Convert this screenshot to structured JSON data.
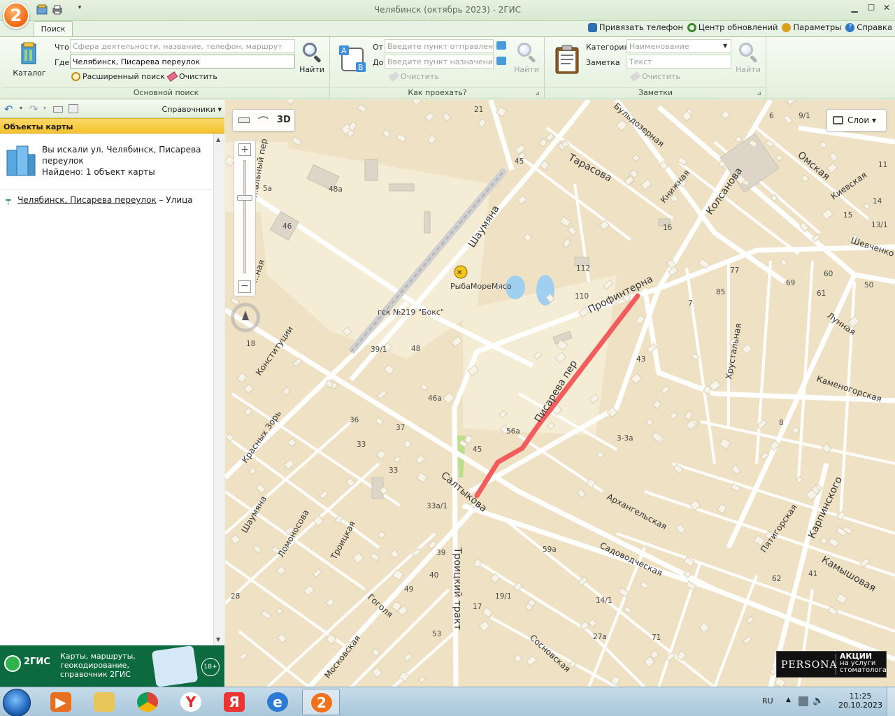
{
  "window": {
    "title": "Челябинск (октябрь 2023) - 2ГИС",
    "logo_text": "2",
    "tab_search": "Поиск",
    "links": [
      "Привязать телефон",
      "Центр обновлений",
      "Параметры",
      "Справка"
    ]
  },
  "ribbon": {
    "main_search": {
      "catalog_label": "Каталог",
      "what_label": "Что",
      "what_placeholder": "Сфера деятельности, название, телефон, маршрут",
      "where_label": "Где",
      "where_value": "Челябинск, Писарева переулок",
      "find_label": "Найти",
      "advanced_label": "Расширенный поиск",
      "clear_label": "Очистить",
      "group_title": "Основной поиск"
    },
    "route": {
      "from_label": "От",
      "from_placeholder": "Введите пункт отправления",
      "to_label": "До",
      "to_placeholder": "Введите пункт назначения",
      "clear_label": "Очистить",
      "find_label": "Найти",
      "group_title": "Как проехать?"
    },
    "notes": {
      "category_label": "Категория",
      "category_placeholder": "Наименование",
      "note_label": "Заметка",
      "note_placeholder": "Текст",
      "clear_label": "Очистить",
      "find_label": "Найти",
      "group_title": "Заметки"
    }
  },
  "left_panel": {
    "toolbar_dropdown": "Справочники",
    "header": "Объекты карты",
    "summary_line1": "Вы искали ул. Челябинск, Писарева",
    "summary_line2": "переулок",
    "summary_found": "Найдено: 1 объект карты",
    "result_link": "Челябинск, Писарева переулок",
    "result_type": " – Улица",
    "banner_brand": "2ГИС",
    "banner_text1": "Карты, маршруты,",
    "banner_text2": "геокодирование,",
    "banner_text3": "справочник 2ГИС",
    "banner_age": "18+"
  },
  "map": {
    "tool_3d": "3D",
    "layers_label": "Слои",
    "streets": {
      "tarasova": "Тарасова",
      "omskaya": "Омская",
      "kolsanova": "Колсанова",
      "shaumyana_top": "Шаумяна",
      "shaumyana_bottom": "Шаумяна",
      "profinterna": "Профинтерна",
      "pisareva": "Писарева пер",
      "saltykova": "Салтыкова",
      "troitsky": "Троицкий тракт",
      "arkhangelskaya": "Архангельская",
      "sadovodcheskaya": "Садоводческая",
      "kamyshovaya": "Камышовая",
      "karpinskogo": "Карпинского",
      "kamenogorskaya": "Каменогорская",
      "khrustalnaya": "Хрустальная",
      "lunnaya": "Лунная",
      "shevchenko": "Шевченко",
      "kievskaya": "Киевская",
      "knizhnaya": "Книжная",
      "buldozernaya": "Бульдозерная",
      "konstitutsii": "Конституции",
      "krasnykh_zor": "Красных Зорь",
      "lomonosova": "Ломоносова",
      "troitskaya": "Троицкая",
      "gogolya": "Гоголя",
      "moskovskaya": "Московская",
      "sosnovskaya": "Сосновская",
      "pyatigorskaya": "Пятигорская",
      "maly_per": "...альный пер",
      "naya": "...ная"
    },
    "poi": {
      "ryba": "РыбаМореМясо",
      "gsk": "гск №219 \"Бокс\""
    },
    "house_numbers": [
      "21",
      "6",
      "9/1",
      "45",
      "48а",
      "5а",
      "46",
      "1б",
      "112",
      "110",
      "77",
      "85",
      "69",
      "61",
      "60",
      "50",
      "13/1",
      "15",
      "14",
      "11",
      "7",
      "43",
      "39/1",
      "48",
      "46а",
      "36",
      "37",
      "33",
      "33",
      "45",
      "56а",
      "3-3а",
      "33а/1",
      "39",
      "40",
      "49",
      "28",
      "17",
      "19/1",
      "59а",
      "53",
      "14/1",
      "27а",
      "71",
      "62",
      "41",
      "8",
      "18"
    ],
    "promo_brand": "PERSONA",
    "promo_text1": "АКЦИИ",
    "promo_text2": "на услуги",
    "promo_text3": "стоматолога"
  },
  "taskbar": {
    "lang": "RU",
    "time": "11:25",
    "date": "20.10.2023",
    "yandex_letter": "Я",
    "app_2gis": "2"
  },
  "colors": {
    "route_highlight": "#f25c5c",
    "ribbon_bg": "#e3f0dc",
    "header_yellow": "#f5c12d",
    "map_bg": "#efe2c4"
  }
}
